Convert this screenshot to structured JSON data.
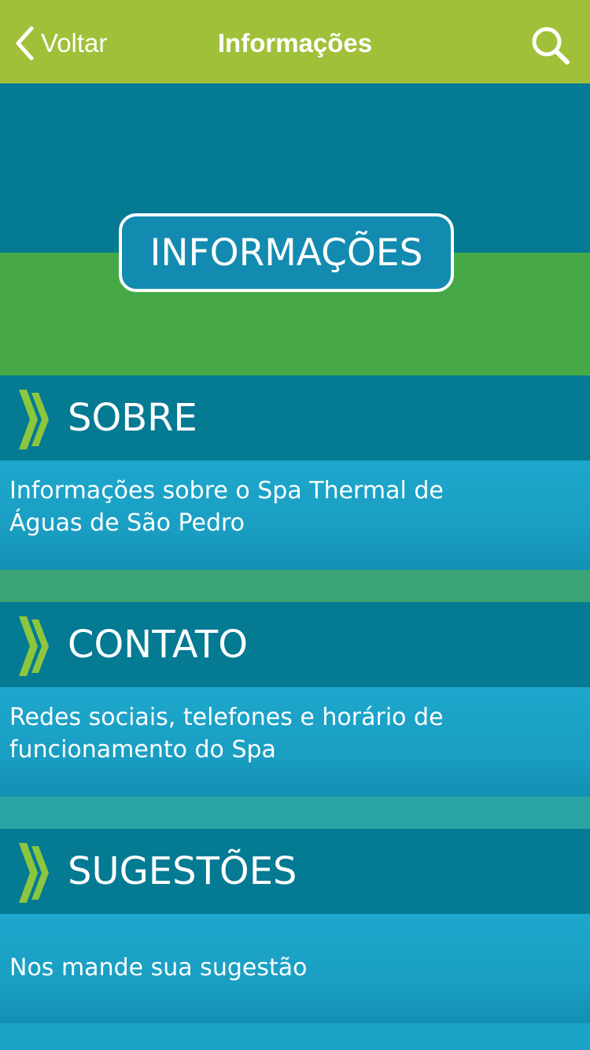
{
  "navbar": {
    "back_label": "Voltar",
    "title": "Informações",
    "search_icon": "search-icon",
    "back_icon": "chevron-left-icon"
  },
  "hero": {
    "badge_text": "INFORMAÇÕES"
  },
  "sections": [
    {
      "title": "SOBRE",
      "description": "Informações sobre o Spa Thermal de Águas de São Pedro",
      "icon": "double-chevron-right-icon"
    },
    {
      "title": "CONTATO",
      "description": "Redes sociais, telefones e horário de funcionamento do Spa",
      "icon": "double-chevron-right-icon"
    },
    {
      "title": "SUGESTÕES",
      "description": "Nos mande sua sugestão",
      "icon": "double-chevron-right-icon"
    }
  ],
  "colors": {
    "navbar_bg": "#a1c03a",
    "section_header_bg": "#047a93",
    "section_body_bg": "#1ba3c7",
    "hero_green": "#46a946",
    "chevron_green": "#8cc63f"
  }
}
